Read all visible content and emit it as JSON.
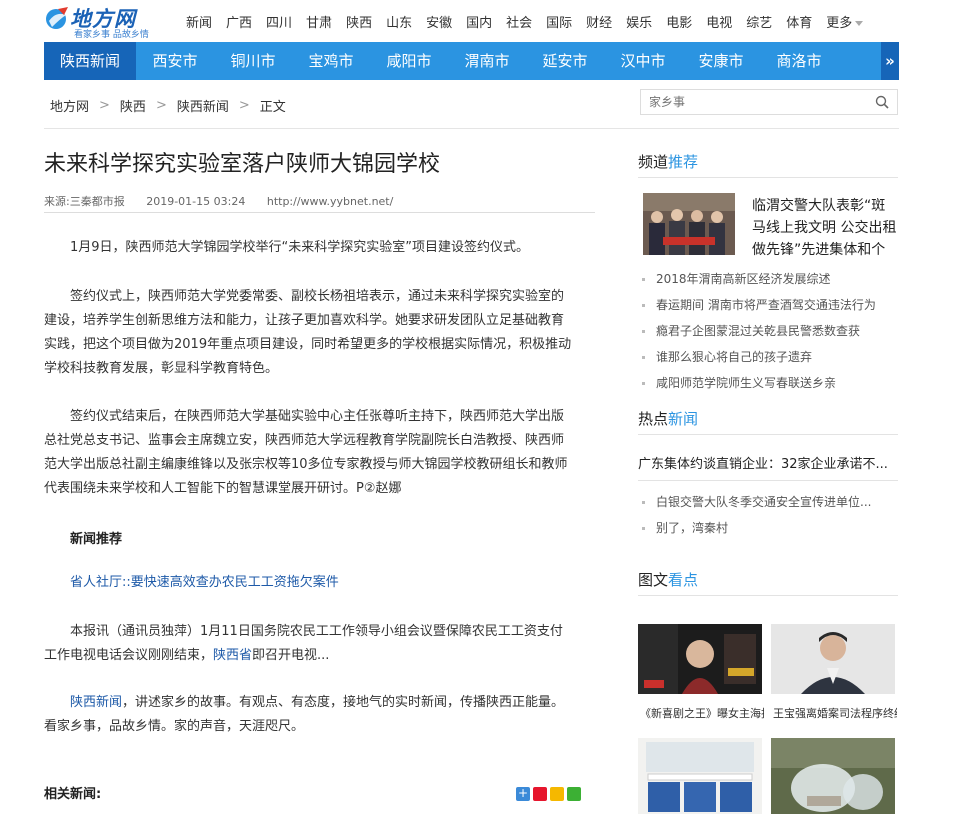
{
  "logo": {
    "title": "地方网",
    "slogan": "看家乡事 品故乡情"
  },
  "topnav": {
    "items": [
      "新闻",
      "广西",
      "四川",
      "甘肃",
      "陕西",
      "山东",
      "安徽",
      "国内",
      "社会",
      "国际",
      "财经",
      "娱乐",
      "电影",
      "电视",
      "综艺",
      "体育"
    ],
    "more": "更多"
  },
  "citynav": {
    "items": [
      "陕西新闻",
      "西安市",
      "铜川市",
      "宝鸡市",
      "咸阳市",
      "渭南市",
      "延安市",
      "汉中市",
      "安康市",
      "商洛市"
    ],
    "scroll": "»"
  },
  "breadcrumb": [
    "地方网",
    "陕西",
    "陕西新闻",
    "正文"
  ],
  "search": {
    "placeholder": "家乡事"
  },
  "article": {
    "title": "未来科学探究实验室落户陕师大锦园学校",
    "source": "来源:三秦都市报",
    "time": "2019-01-15 03:24",
    "url": "http://www.yybnet.net/",
    "p1": "1月9日，陕西师范大学锦园学校举行“未来科学探究实验室”项目建设签约仪式。",
    "p2_l1": "签约仪式上，陕西师范大学党委常委、副校长杨祖培表示，通过未来科学探究实验室的",
    "p2_l2": "建设，培养学生创新思维方法和能力，让孩子更加喜欢科学。她要求研发团队立足基础教育",
    "p2_l3": "实践，把这个项目做为2019年重点项目建设，同时希望更多的学校根据实际情况，积极推动",
    "p2_l4": "学校科技教育发展，彰显科学教育特色。",
    "p3_l1": "签约仪式结束后，在陕西师范大学基础实验中心主任张尊听主持下，陕西师范大学出版",
    "p3_l2": "总社党总支书记、监事会主席魏立安，陕西师范大学远程教育学院副院长白浩教授、陕西师",
    "p3_l3": "范大学出版总社副主编康维锋以及张宗权等10多位专家教授与师大锦园学校教研组长和教师",
    "p3_l4": "代表围绕未来学校和人工智能下的智慧课堂展开研讨。P②赵娜",
    "recommend_heading": "新闻推荐",
    "recommend_link": "省人社厅::要快速高效查办农民工工资拖欠案件",
    "recommend_l1": "本报讯（通讯员独萍）1月11日国务院农民工工作领导小组会议暨保障农民工工资支付",
    "recommend_l2a": "工作电视电话会议刚刚结束，",
    "recommend_l2_link": "陕西省",
    "recommend_l2b": "即召开电视...",
    "promo_link": "陕西新闻",
    "promo_l1": "，讲述家乡的故事。有观点、有态度，接地气的实时新闻，传播陕西正能量。",
    "promo_l2": "看家乡事，品故乡情。家的声音，天涯咫尺。",
    "related_heading": "相关新闻:"
  },
  "sidebar": {
    "channel": {
      "head_a": "频道",
      "head_b": "推荐"
    },
    "feature_title": "临渭交警大队表彰“斑马线上我文明 公交出租做先锋”先进集体和个",
    "channel_list": [
      "2018年渭南高新区经济发展综述",
      "春运期间 渭南市将严查酒驾交通违法行为",
      "瘾君子企图蒙混过关乾县民警悉数查获",
      "谁那么狠心将自己的孩子遗弃",
      "咸阳师范学院师生义写春联送乡亲"
    ],
    "hot": {
      "head_a": "热点",
      "head_b": "新闻"
    },
    "hot_top": "广东集体约谈直销企业：32家企业承诺不...",
    "hot_list": [
      "白银交警大队冬季交通安全宣传进单位...",
      "别了，湾秦村"
    ],
    "pics": {
      "head_a": "图文",
      "head_b": "看点"
    },
    "pic_captions": [
      "《新喜剧之王》曝女主海报",
      "王宝强离婚案司法程序终结"
    ]
  },
  "colors": {
    "brand_blue": "#2b94e1",
    "nav_active": "#1665b8",
    "link_blue": "#1e5aa8"
  }
}
